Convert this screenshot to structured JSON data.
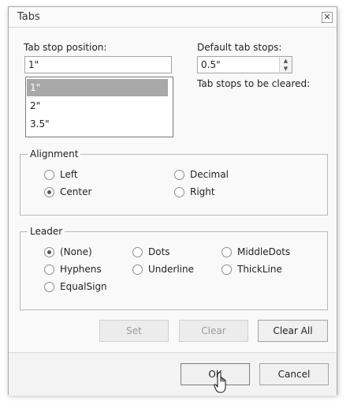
{
  "dialog": {
    "title": "Tabs",
    "close_label": "✕"
  },
  "tab_stop": {
    "label": "Tab stop position:",
    "value": "1\"",
    "items": [
      "1\"",
      "2\"",
      "3.5\""
    ],
    "selected_index": 0
  },
  "default_tab_stops": {
    "label": "Default tab stops:",
    "value": "0.5\""
  },
  "cleared": {
    "label": "Tab stops to be cleared:"
  },
  "alignment": {
    "legend": "Alignment",
    "options": [
      "Left",
      "Decimal",
      "Center",
      "Right"
    ],
    "selected": "Center"
  },
  "leader": {
    "legend": "Leader",
    "options": [
      "(None)",
      "Dots",
      "MiddleDots",
      "Hyphens",
      "Underline",
      "ThickLine",
      "EqualSign"
    ],
    "selected": "(None)"
  },
  "buttons": {
    "set": "Set",
    "clear": "Clear",
    "clear_all": "Clear All",
    "ok": "OK",
    "cancel": "Cancel"
  }
}
